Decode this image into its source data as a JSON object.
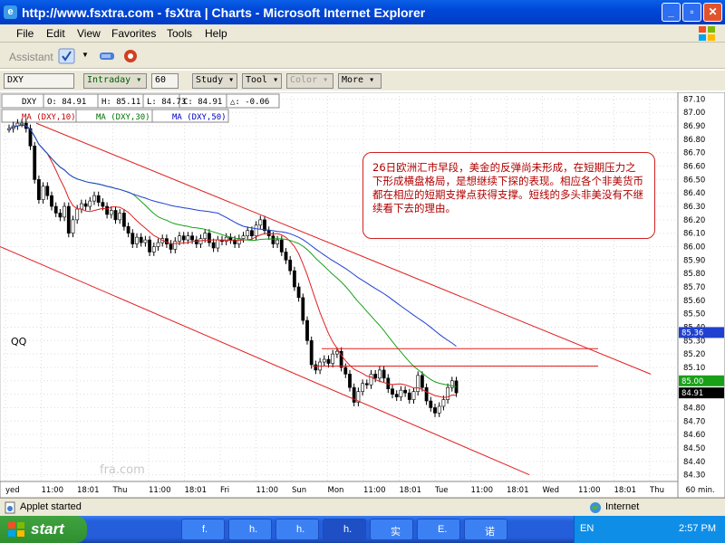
{
  "window": {
    "title": "http://www.fsxtra.com - fsXtra | Charts - Microsoft Internet Explorer"
  },
  "menu": [
    "File",
    "Edit",
    "View",
    "Favorites",
    "Tools",
    "Help"
  ],
  "assistant_label": "Assistant",
  "controls": {
    "symbol": "DXY",
    "interval": "Intraday",
    "period": "60",
    "study": "Study",
    "tool": "Tool",
    "color": "Color",
    "more": "More"
  },
  "ohlc": {
    "sym": "DXY",
    "open": "O: 84.91",
    "high": "H: 85.11",
    "low": "L: 84.73",
    "close": "C: 84.91",
    "change": "△: -0.06"
  },
  "indicators": [
    "MA (DXY,10)",
    "MA (DXY,30)",
    "MA (DXY,50)"
  ],
  "annotation": {
    "text": "26日欧洲汇市早段，美金的反弹尚未形成，在短期压力之下形成横盘格局，是想继续下探的表现。相应各个非美货币都在相应的短期支撑点获得支撑。短线的多头非美没有不继续看下去的理由。"
  },
  "watermark": "fra.com",
  "qq_label": "QQ",
  "price_markers": {
    "ma_last": "85.36",
    "ma_mid": "85.00",
    "last": "84.91"
  },
  "chart_data": {
    "type": "candlestick",
    "ylim": [
      84.25,
      87.15
    ],
    "yticks": [
      "87.10",
      "87.00",
      "86.90",
      "86.80",
      "86.70",
      "86.60",
      "86.50",
      "86.40",
      "86.30",
      "86.20",
      "86.10",
      "86.00",
      "85.90",
      "85.80",
      "85.70",
      "85.60",
      "85.50",
      "85.40",
      "85.30",
      "85.20",
      "85.10",
      "85.00",
      "84.90",
      "84.80",
      "84.70",
      "84.60",
      "84.50",
      "84.40",
      "84.30"
    ],
    "xticks": [
      "yed",
      "11:00",
      "18:01",
      "Thu",
      "11:00",
      "18:01",
      "Fri",
      "11:00",
      "Sun",
      "Mon",
      "11:00",
      "18:01",
      "Tue",
      "11:00",
      "18:01",
      "Wed",
      "11:00",
      "18:01",
      "Thu",
      "60 min."
    ],
    "closes": [
      86.88,
      86.9,
      86.92,
      86.92,
      86.88,
      86.75,
      86.5,
      86.35,
      86.45,
      86.38,
      86.3,
      86.25,
      86.22,
      86.3,
      86.1,
      86.2,
      86.28,
      86.32,
      86.3,
      86.34,
      86.38,
      86.33,
      86.3,
      86.24,
      86.27,
      86.2,
      86.25,
      86.15,
      86.1,
      86.02,
      86.07,
      86.03,
      86.05,
      85.96,
      86.0,
      86.03,
      86.06,
      86.02,
      85.98,
      86.04,
      86.08,
      86.05,
      86.08,
      86.05,
      86.02,
      86.06,
      86.1,
      86.03,
      85.99,
      86.05,
      86.04,
      86.07,
      86.05,
      86.02,
      86.06,
      86.08,
      86.12,
      86.08,
      86.16,
      86.2,
      86.12,
      86.08,
      86.02,
      86.05,
      85.96,
      85.9,
      85.82,
      85.7,
      85.62,
      85.45,
      85.3,
      85.12,
      85.08,
      85.14,
      85.16,
      85.13,
      85.2,
      85.22,
      85.1,
      85.05,
      84.95,
      84.84,
      84.92,
      84.98,
      84.97,
      85.05,
      85.02,
      85.08,
      85.02,
      84.94,
      84.9,
      84.88,
      84.93,
      84.91,
      84.86,
      84.92,
      85.04,
      84.95,
      84.85,
      84.8,
      84.76,
      84.81,
      84.86,
      84.95,
      85.0,
      84.91
    ],
    "series": [
      {
        "name": "MA (DXY,10)",
        "color": "#e02020"
      },
      {
        "name": "MA (DXY,30)",
        "color": "#18a018"
      },
      {
        "name": "MA (DXY,50)",
        "color": "#2040d0"
      }
    ],
    "trendlines_color": "#e02020",
    "resistance_levels": [
      85.24,
      85.11
    ]
  }
}
